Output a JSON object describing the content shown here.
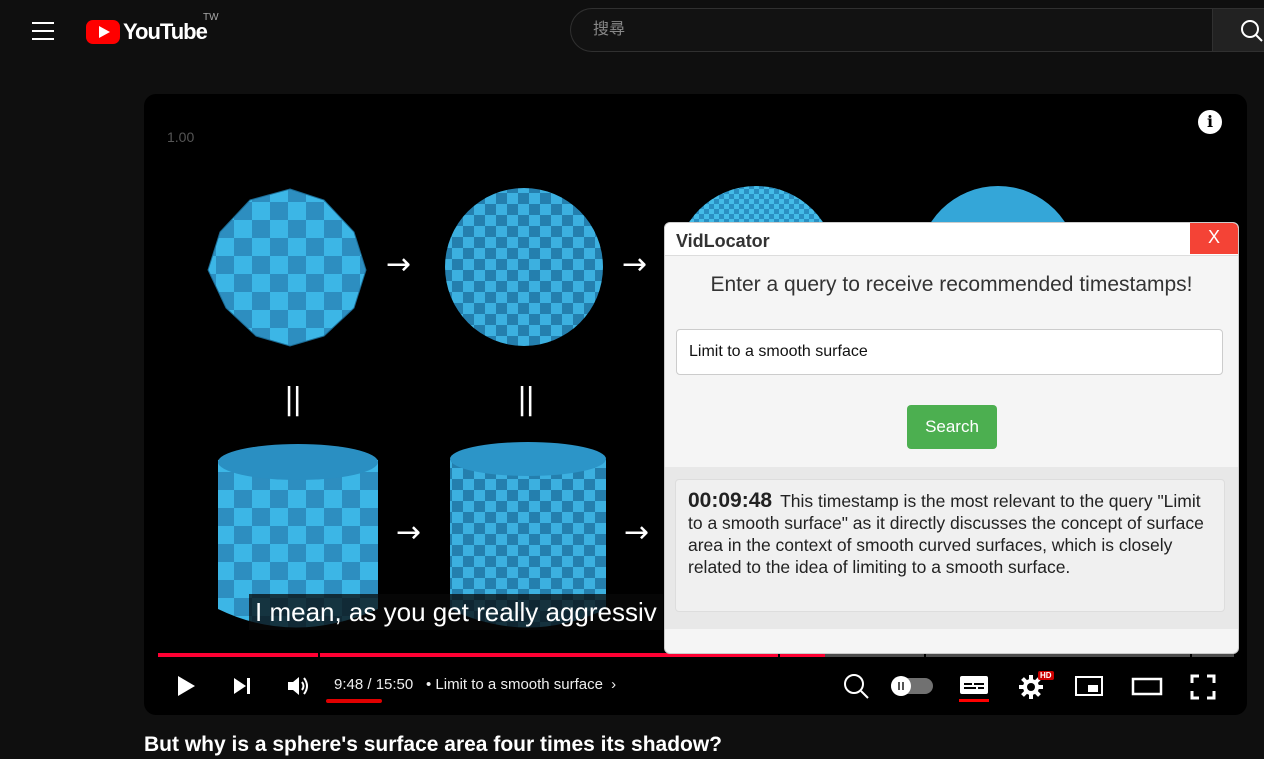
{
  "header": {
    "logo_text": "YouTube",
    "region": "TW",
    "search_placeholder": "搜尋"
  },
  "player": {
    "speed_label": "1.00",
    "subtitle": "I mean, as you get really aggressiv",
    "progress_played": 0.62,
    "progress_loaded": 0.6,
    "time_display": "9:48 / 15:50",
    "chapter_title": "• Limit to a smooth surface",
    "hd_badge": "HD"
  },
  "video": {
    "title": "But why is a sphere's surface area four times its shadow?"
  },
  "vidlocator": {
    "title": "VidLocator",
    "close_label": "X",
    "prompt": "Enter a query to receive recommended timestamps!",
    "query_value": "Limit to a smooth surface",
    "search_label": "Search",
    "results": [
      {
        "timestamp": "00:09:48",
        "text": "This timestamp is the most relevant to the query \"Limit to a smooth surface\" as it directly discusses the concept of surface area in the context of smooth curved surfaces, which is closely related to the idea of limiting to a smooth surface."
      }
    ]
  },
  "colors": {
    "accent_red": "#ff0000",
    "search_green": "#4caf50",
    "close_red": "#f44336",
    "shape_blue": "#2ba3d6"
  }
}
